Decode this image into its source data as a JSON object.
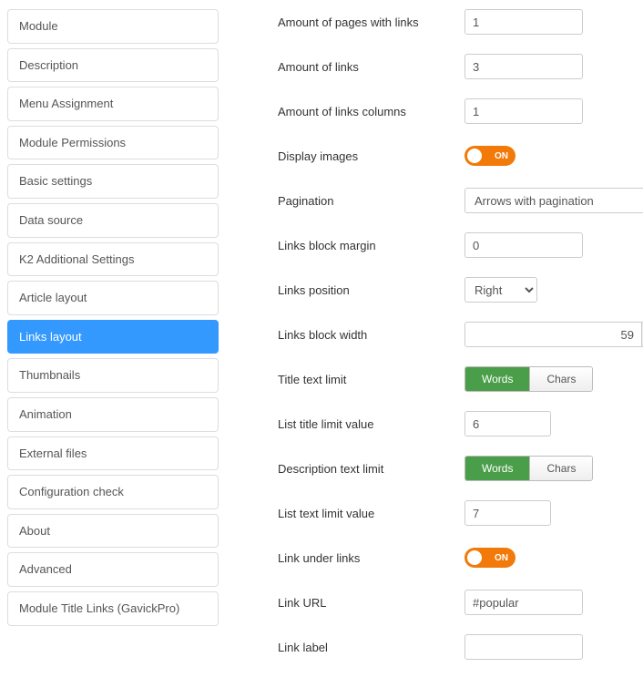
{
  "sidebar": {
    "items": [
      {
        "label": "Module",
        "id": "module"
      },
      {
        "label": "Description",
        "id": "description"
      },
      {
        "label": "Menu Assignment",
        "id": "menu-assignment"
      },
      {
        "label": "Module Permissions",
        "id": "module-permissions"
      },
      {
        "label": "Basic settings",
        "id": "basic-settings"
      },
      {
        "label": "Data source",
        "id": "data-source"
      },
      {
        "label": "K2 Additional Settings",
        "id": "k2-additional-settings"
      },
      {
        "label": "Article layout",
        "id": "article-layout"
      },
      {
        "label": "Links layout",
        "id": "links-layout"
      },
      {
        "label": "Thumbnails",
        "id": "thumbnails"
      },
      {
        "label": "Animation",
        "id": "animation"
      },
      {
        "label": "External files",
        "id": "external-files"
      },
      {
        "label": "Configuration check",
        "id": "configuration-check"
      },
      {
        "label": "About",
        "id": "about"
      },
      {
        "label": "Advanced",
        "id": "advanced"
      },
      {
        "label": "Module Title Links (GavickPro)",
        "id": "module-title-links"
      }
    ],
    "active": "links-layout"
  },
  "form": {
    "amount_pages": {
      "label": "Amount of pages with links",
      "value": "1"
    },
    "amount_links": {
      "label": "Amount of links",
      "value": "3"
    },
    "amount_cols": {
      "label": "Amount of links columns",
      "value": "1"
    },
    "display_images": {
      "label": "Display images",
      "value": "ON"
    },
    "pagination": {
      "label": "Pagination",
      "value": "Arrows with pagination"
    },
    "block_margin": {
      "label": "Links block margin",
      "value": "0"
    },
    "position": {
      "label": "Links position",
      "value": "Right"
    },
    "block_width": {
      "label": "Links block width",
      "value": "59",
      "unit": "%"
    },
    "title_limit": {
      "label": "Title text limit",
      "words": "Words",
      "chars": "Chars",
      "selected": "words"
    },
    "title_limit_val": {
      "label": "List title limit value",
      "value": "6"
    },
    "desc_limit": {
      "label": "Description text limit",
      "words": "Words",
      "chars": "Chars",
      "selected": "words"
    },
    "text_limit_val": {
      "label": "List text limit value",
      "value": "7"
    },
    "link_under": {
      "label": "Link under links",
      "value": "ON"
    },
    "link_url": {
      "label": "Link URL",
      "value": "#popular"
    },
    "link_label": {
      "label": "Link label",
      "value": ""
    }
  }
}
